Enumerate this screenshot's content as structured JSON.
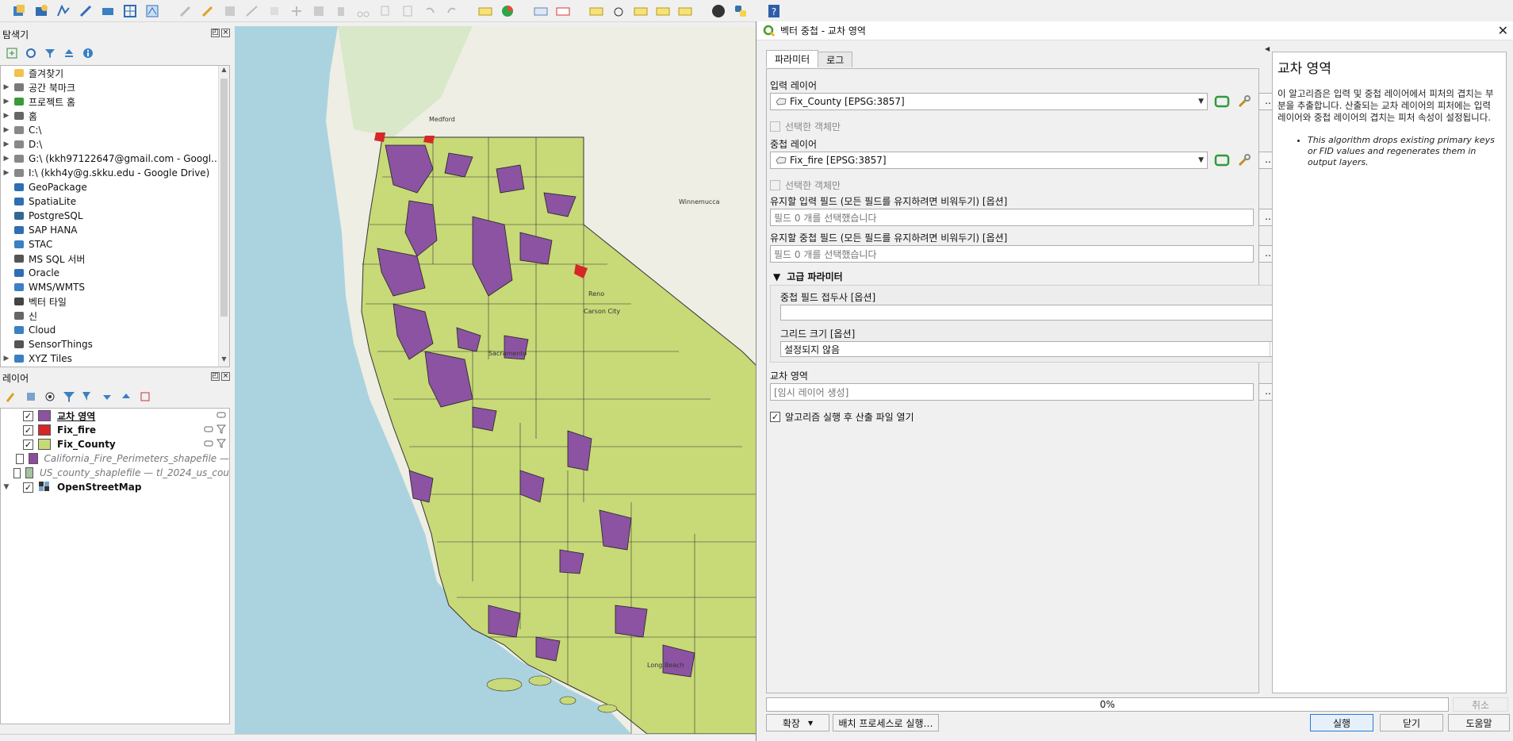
{
  "colors": {
    "intersection_purple": "#8b53a2",
    "fire_red": "#d62728",
    "county_yellowgreen": "#c8d978",
    "ca_fire_purple": "#8e4b9b",
    "us_county_green": "#a5c3a0",
    "ocean": "#abd3df",
    "primary_btn_border": "#2a7ad5"
  },
  "browser": {
    "title": "탐색기",
    "items": [
      {
        "label": "즐겨찾기",
        "icon": "star-icon",
        "expandable": false
      },
      {
        "label": "공간 북마크",
        "icon": "bookmark-icon",
        "expandable": true
      },
      {
        "label": "프로젝트 홈",
        "icon": "project-home-icon",
        "expandable": true
      },
      {
        "label": "홈",
        "icon": "home-folder-icon",
        "expandable": true
      },
      {
        "label": "C:\\",
        "icon": "drive-icon",
        "expandable": true
      },
      {
        "label": "D:\\",
        "icon": "drive-icon",
        "expandable": true
      },
      {
        "label": "G:\\ (kkh97122647@gmail.com - Googl...)",
        "icon": "drive-icon",
        "expandable": true
      },
      {
        "label": "I:\\ (kkh4y@g.skku.edu - Google Drive)",
        "icon": "drive-icon",
        "expandable": true
      },
      {
        "label": "GeoPackage",
        "icon": "geopackage-icon",
        "expandable": false
      },
      {
        "label": "SpatiaLite",
        "icon": "spatialite-icon",
        "expandable": false
      },
      {
        "label": "PostgreSQL",
        "icon": "postgresql-icon",
        "expandable": false
      },
      {
        "label": "SAP HANA",
        "icon": "sap-hana-icon",
        "expandable": false
      },
      {
        "label": "STAC",
        "icon": "stac-icon",
        "expandable": false
      },
      {
        "label": "MS SQL 서버",
        "icon": "mssql-icon",
        "expandable": false
      },
      {
        "label": "Oracle",
        "icon": "oracle-icon",
        "expandable": false
      },
      {
        "label": "WMS/WMTS",
        "icon": "wms-icon",
        "expandable": false
      },
      {
        "label": "벡터 타일",
        "icon": "vector-tile-icon",
        "expandable": false
      },
      {
        "label": "신",
        "icon": "scene-icon",
        "expandable": false
      },
      {
        "label": "Cloud",
        "icon": "cloud-icon",
        "expandable": false
      },
      {
        "label": "SensorThings",
        "icon": "sensorthings-icon",
        "expandable": false
      },
      {
        "label": "XYZ Tiles",
        "icon": "xyz-tiles-icon",
        "expandable": true
      }
    ]
  },
  "layers": {
    "title": "레이어",
    "items": [
      {
        "label": "교차 영역",
        "checked": true,
        "color": "#8b53a2",
        "bold": true,
        "underline": true,
        "italic": false
      },
      {
        "label": "Fix_fire",
        "checked": true,
        "color": "#d62728",
        "bold": true,
        "underline": false,
        "italic": false
      },
      {
        "label": "Fix_County",
        "checked": true,
        "color": "#c8d978",
        "bold": true,
        "underline": false,
        "italic": false
      },
      {
        "label": "California_Fire_Perimeters_shapefile —",
        "checked": false,
        "color": "#8e4b9b",
        "bold": false,
        "underline": false,
        "italic": true
      },
      {
        "label": "US_county_shaplefile — tl_2024_us_cou",
        "checked": false,
        "color": "#a5c3a0",
        "bold": false,
        "underline": false,
        "italic": true
      },
      {
        "label": "OpenStreetMap",
        "checked": true,
        "color": "",
        "bold": true,
        "underline": false,
        "italic": false
      }
    ]
  },
  "map": {
    "labels": [
      "Medford",
      "Winnemucca",
      "Reno",
      "Carson City",
      "Sacramento",
      "Long Beach"
    ]
  },
  "dialog": {
    "title": "벡터 중첩 - 교차 영역",
    "tabs": [
      "파라미터",
      "로그"
    ],
    "input_layer_label": "입력 레이어",
    "input_layer_value": "Fix_County [EPSG:3857]",
    "selected_only_1": "선택한 객체만",
    "overlay_layer_label": "중첩 레이어",
    "overlay_layer_value": "Fix_fire [EPSG:3857]",
    "selected_only_2": "선택한 객체만",
    "input_fields_label": "유지할 입력 필드 (모든 필드를 유지하려면 비워두기) [옵션]",
    "input_fields_value": "필드 0 개를 선택했습니다",
    "overlay_fields_label": "유지할 중첩 필드 (모든 필드를 유지하려면 비워두기) [옵션]",
    "overlay_fields_value": "필드 0 개를 선택했습니다",
    "advanced_title": "고급 파라미터",
    "overlay_prefix_label": "중첩 필드 접두사 [옵션]",
    "overlay_prefix_value": "",
    "grid_size_label": "그리드 크기 [옵션]",
    "grid_size_value": "설정되지 않음",
    "output_label": "교차 영역",
    "output_placeholder": "[임시 레이어 생성]",
    "open_after_label": "알고리즘 실행 후 산출 파일 열기",
    "open_after_checked": true,
    "ellipsis": "…",
    "help_title": "교차 영역",
    "help_text": "이 알고리즘은 입력 및 중첩 레이어에서 피처의 겹치는 부분을 추출합니다. 산출되는 교차 레이어의 피처에는 입력 레이어와 중첩 레이어의 겹치는 피처 속성이 설정됩니다.",
    "help_note": "This algorithm drops existing primary keys or FID values and regenerates them in output layers.",
    "progress_text": "0%",
    "progress_value": 0,
    "cancel_label": "취소",
    "advanced_btn": "확장",
    "batch_btn": "배치 프로세스로 실행…",
    "run_btn": "실행",
    "close_btn": "닫기",
    "help_btn": "도움말"
  }
}
